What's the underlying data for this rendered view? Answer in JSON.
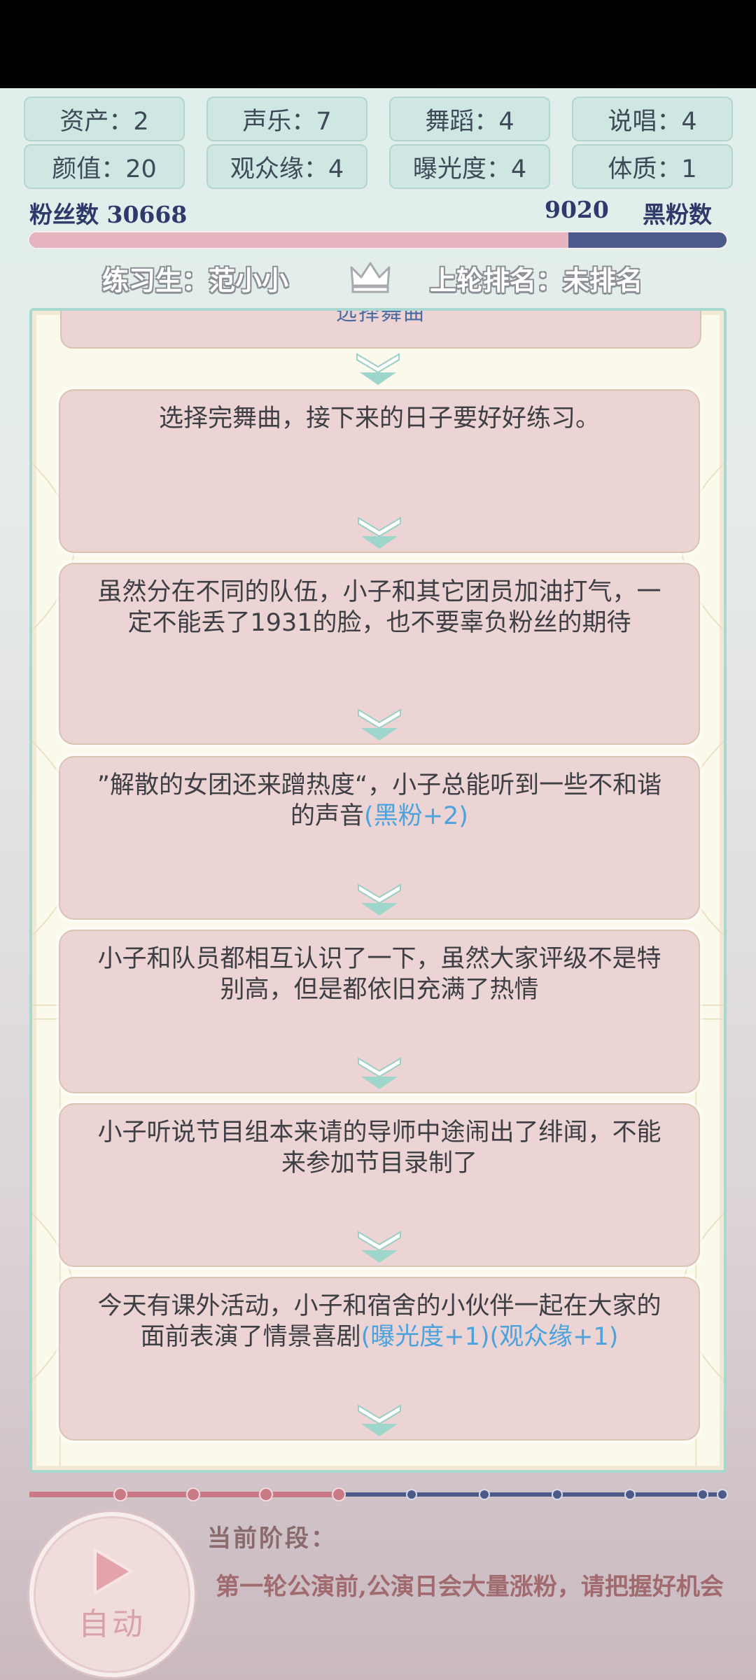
{
  "stats": [
    {
      "label": "资产：2"
    },
    {
      "label": "声乐：7"
    },
    {
      "label": "舞蹈：4"
    },
    {
      "label": "说唱：4"
    },
    {
      "label": "颜值：20"
    },
    {
      "label": "观众缘：4"
    },
    {
      "label": "曝光度：4"
    },
    {
      "label": "体质：1"
    }
  ],
  "fans": {
    "fan_label": "粉丝数 30668",
    "anti_value": "9020",
    "anti_label": "黑粉数",
    "fan_count": 30668,
    "anti_count": 9020
  },
  "trainee": {
    "name_label": "练习生：范小小",
    "rank_label": "上轮排名：未排名"
  },
  "story": {
    "top_card": "选择舞曲",
    "cards": [
      {
        "text": "选择完舞曲，接下来的日子要好好练习。",
        "bonus": ""
      },
      {
        "text": "虽然分在不同的队伍，小子和其它团员加油打气，一定不能丢了1931的脸，也不要辜负粉丝的期待",
        "bonus": ""
      },
      {
        "text": "”解散的女团还来蹭热度“，小子总能听到一些不和谐的声音",
        "bonus": "(黑粉+2)"
      },
      {
        "text": "小子和队员都相互认识了一下，虽然大家评级不是特别高，但是都依旧充满了热情",
        "bonus": ""
      },
      {
        "text": "小子听说节目组本来请的导师中途闹出了绯闻，不能来参加节目录制了",
        "bonus": ""
      },
      {
        "text": "今天有课外活动，小子和宿舍的小伙伴一起在大家的面前表演了情景喜剧",
        "bonus": "(曝光度+1)(观众缘+1)"
      }
    ]
  },
  "progress": {
    "completed_steps": 4,
    "total_steps": 10,
    "done_color": "#c97b85",
    "todo_color": "#4c5a8a"
  },
  "stage": {
    "label": "当前阶段：",
    "text": "第一轮公演前,公演日会大量涨粉，请把握好机会"
  },
  "auto_button": {
    "label": "自动",
    "icon": "play-icon"
  }
}
